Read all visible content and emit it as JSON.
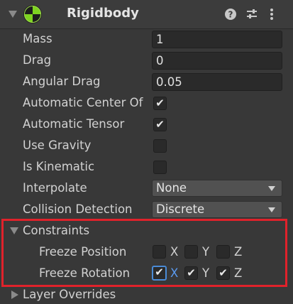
{
  "component": {
    "title": "Rigidbody",
    "icons": [
      "help-icon",
      "presets-icon",
      "more-options-icon"
    ]
  },
  "properties": {
    "mass_label": "Mass",
    "mass_value": "1",
    "drag_label": "Drag",
    "drag_value": "0",
    "angular_drag_label": "Angular Drag",
    "angular_drag_value": "0.05",
    "auto_center_label": "Automatic Center Of",
    "auto_center_checked": true,
    "auto_tensor_label": "Automatic Tensor",
    "auto_tensor_checked": true,
    "use_gravity_label": "Use Gravity",
    "use_gravity_checked": false,
    "is_kinematic_label": "Is Kinematic",
    "is_kinematic_checked": false,
    "interpolate_label": "Interpolate",
    "interpolate_value": "None",
    "collision_label": "Collision Detection",
    "collision_value": "Discrete"
  },
  "constraints": {
    "label": "Constraints",
    "freeze_position_label": "Freeze Position",
    "freeze_position": {
      "X": false,
      "Y": false,
      "Z": false
    },
    "freeze_rotation_label": "Freeze Rotation",
    "freeze_rotation": {
      "X": true,
      "Y": true,
      "Z": true
    },
    "axis_x": "X",
    "axis_y": "Y",
    "axis_z": "Z"
  },
  "layer_overrides": {
    "label": "Layer Overrides"
  },
  "colors": {
    "highlight_box": "#e0222b",
    "focus_blue": "#5b9bf0"
  }
}
